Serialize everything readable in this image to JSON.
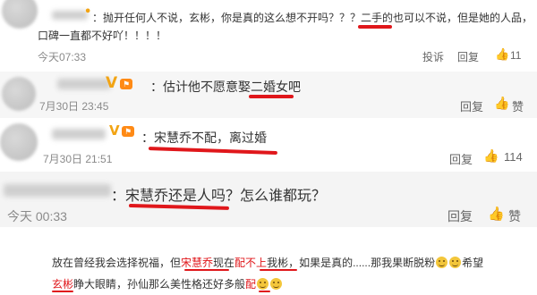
{
  "comments": [
    {
      "line1": "：抛开任何人不说，玄彬，你是真的这么想不开吗？？？二手的也可以不说，但是她的人品，",
      "line2": "口碑一直都不好吖！！！！",
      "time": "今天07:33",
      "report": "投诉",
      "reply": "回复",
      "likes": "11"
    },
    {
      "text": "：估计他不愿意娶二婚女吧",
      "badge": "V",
      "time": "7月30日 23:45",
      "reply": "回复",
      "likes": "赞"
    },
    {
      "text": "：宋慧乔不配，离过婚",
      "badge": "V",
      "time": "7月30日 21:51",
      "reply": "回复",
      "likes": "114"
    },
    {
      "text": "：宋慧乔还是人吗？怎么谁都玩？",
      "time": "今天 00:33",
      "reply": "回复",
      "likes": "赞"
    }
  ],
  "footer": {
    "p1": "放在曾经我会选择祝福，但",
    "h1": "宋慧乔",
    "p2": "现在",
    "h2": "配不上",
    "p3": "我彬，如果是真的......那我果断脱粉",
    "p4": "希望",
    "h3": "玄彬",
    "p5": "睁大眼睛，孙仙那么美性格还好多般",
    "h4": "配"
  },
  "colors": {
    "underline": "#e0171b",
    "badge": "#f2a414",
    "background": "#ffffff"
  }
}
